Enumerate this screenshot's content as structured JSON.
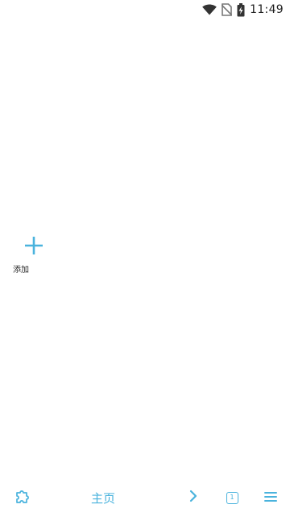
{
  "status_bar": {
    "time": "11:49",
    "icons": [
      "wifi-icon",
      "no-sim-icon",
      "battery-charging-icon"
    ]
  },
  "shortcuts": {
    "add_label": "添加",
    "add_icon": "plus-icon"
  },
  "toolbar": {
    "extensions_icon": "puzzle-icon",
    "home_label": "主页",
    "forward_icon": "chevron-right-icon",
    "tab_count": "1",
    "menu_icon": "hamburger-menu-icon"
  },
  "colors": {
    "accent": "#4ab3dd",
    "background": "#ffffff",
    "status_text": "#222222"
  }
}
